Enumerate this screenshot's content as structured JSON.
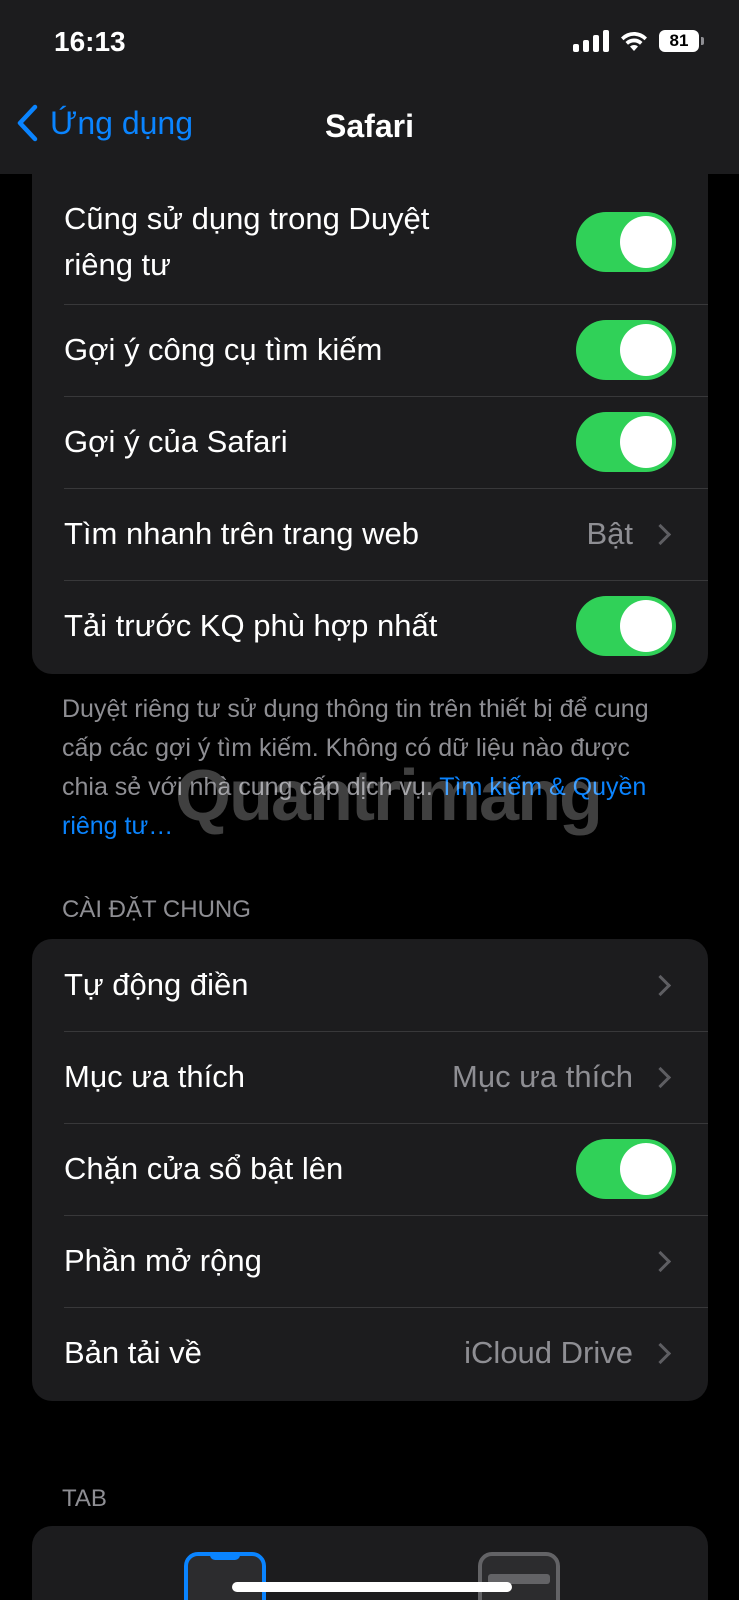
{
  "status": {
    "time": "16:13",
    "battery": "81"
  },
  "nav": {
    "back_label": "Ứng dụng",
    "title": "Safari"
  },
  "group_search": {
    "rows": [
      {
        "label": "Cũng sử dụng trong Duyệt riêng tư",
        "toggle": true
      },
      {
        "label": "Gợi ý công cụ tìm kiếm",
        "toggle": true
      },
      {
        "label": "Gợi ý của Safari",
        "toggle": true
      },
      {
        "label": "Tìm nhanh trên trang web",
        "value": "Bật"
      },
      {
        "label": "Tải trước KQ phù hợp nhất",
        "toggle": true
      }
    ]
  },
  "footnote": {
    "text": "Duyệt riêng tư sử dụng thông tin trên thiết bị để cung cấp các gợi ý tìm kiếm. Không có dữ liệu nào được chia sẻ với nhà cung cấp dịch vụ. ",
    "link": "Tìm kiếm & Quyền riêng tư…"
  },
  "watermark": "Quantrimang",
  "section_general": {
    "header": "CÀI ĐẶT CHUNG",
    "rows": [
      {
        "label": "Tự động điền"
      },
      {
        "label": "Mục ưa thích",
        "value": "Mục ưa thích"
      },
      {
        "label": "Chặn cửa sổ bật lên",
        "toggle": true
      },
      {
        "label": "Phần mở rộng"
      },
      {
        "label": "Bản tải về",
        "value": "iCloud Drive"
      }
    ]
  },
  "section_tab": {
    "header": "TAB"
  },
  "colors": {
    "accent": "#0a84ff",
    "toggle_on": "#30d158",
    "cell_bg": "#1c1c1e",
    "secondary_text": "#8e8e93"
  }
}
